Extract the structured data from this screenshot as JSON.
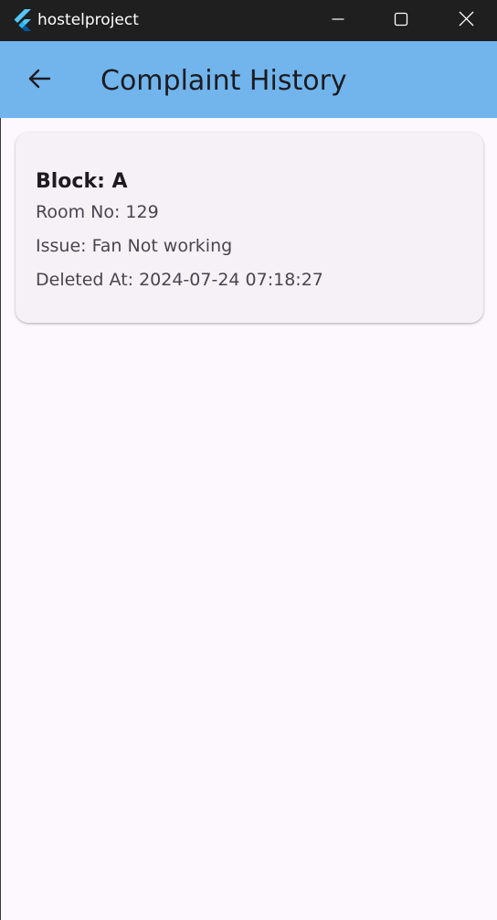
{
  "window": {
    "title": "hostelproject"
  },
  "appbar": {
    "title": "Complaint History"
  },
  "complaints": [
    {
      "block": "Block: A",
      "room": "Room No: 129",
      "issue": "Issue: Fan Not working",
      "deleted_at": "Deleted At: 2024-07-24 07:18:27"
    }
  ],
  "colors": {
    "titlebar": "#1f1f1f",
    "appbar": "#71b5ec",
    "background": "#fdf7fe",
    "card": "#f6f1f7"
  },
  "icons": {
    "app": "flutter-logo-icon",
    "minimize": "minimize-icon",
    "maximize": "maximize-icon",
    "close": "close-icon",
    "back": "arrow-left-icon"
  }
}
